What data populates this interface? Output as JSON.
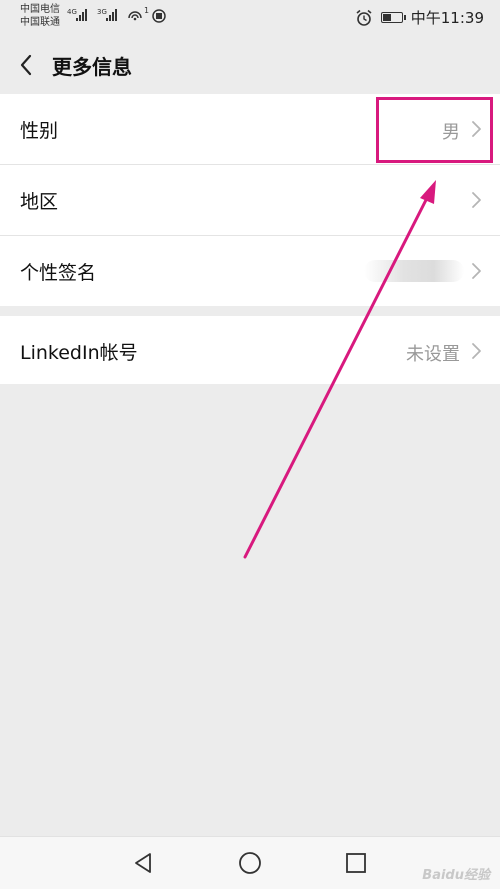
{
  "status_bar": {
    "carrier_1": "中国电信",
    "carrier_2": "中国联通",
    "network_1": "4G",
    "network_2": "3G",
    "hotspot_badge": "1",
    "time": "中午11:39"
  },
  "header": {
    "title": "更多信息"
  },
  "list": {
    "gender": {
      "label": "性别",
      "value": "男"
    },
    "region": {
      "label": "地区",
      "value": ""
    },
    "signature": {
      "label": "个性签名",
      "value": ""
    },
    "linkedin": {
      "label": "LinkedIn帐号",
      "value": "未设置"
    }
  },
  "watermark": "Baidu经验",
  "colors": {
    "annotation": "#d8197e",
    "background": "#ececec",
    "value_text": "#999999"
  },
  "icons": [
    "back-chevron-icon",
    "chevron-right-icon",
    "nav-back-triangle-icon",
    "nav-home-circle-icon",
    "nav-recents-square-icon",
    "alarm-icon",
    "battery-icon",
    "hotspot-icon"
  ]
}
